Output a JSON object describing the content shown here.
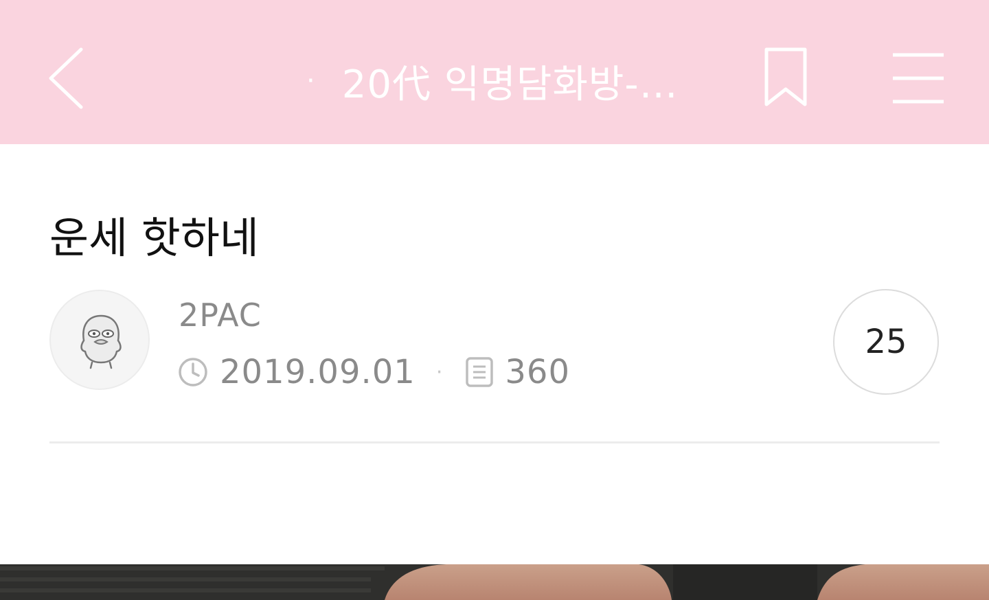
{
  "header": {
    "title_prefix": "·",
    "title": "20代 익명담화방-…",
    "background": "#fad4df",
    "icons": [
      "back-icon",
      "bookmark-icon",
      "menu-icon"
    ]
  },
  "post": {
    "title": "운세 핫하네",
    "author": "2PAC",
    "date": "2019.09.01",
    "separator": "·",
    "views": "360",
    "comment_count": "25"
  },
  "colors": {
    "accent": "#fad4df",
    "meta_text": "#8a8a8a",
    "title_text": "#111111"
  }
}
